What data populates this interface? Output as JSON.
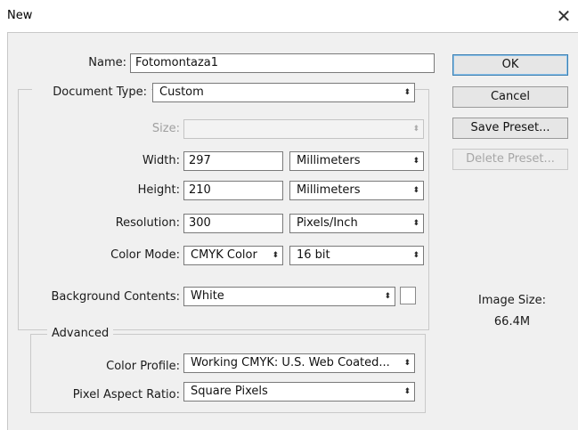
{
  "window": {
    "title": "New",
    "close_glyph": "✕"
  },
  "form": {
    "name_label": "Name:",
    "name_value": "Fotomontaza1",
    "document_type_label": "Document Type:",
    "document_type_value": "Custom",
    "size_label": "Size:",
    "size_value": "",
    "width_label": "Width:",
    "width_value": "297",
    "width_unit": "Millimeters",
    "height_label": "Height:",
    "height_value": "210",
    "height_unit": "Millimeters",
    "resolution_label": "Resolution:",
    "resolution_value": "300",
    "resolution_unit": "Pixels/Inch",
    "color_mode_label": "Color Mode:",
    "color_mode_value": "CMYK Color",
    "bit_depth_value": "16 bit",
    "background_label": "Background Contents:",
    "background_value": "White",
    "background_swatch_color": "#ffffff"
  },
  "advanced": {
    "legend": "Advanced",
    "color_profile_label": "Color Profile:",
    "color_profile_value": "Working CMYK:  U.S. Web Coated...",
    "pixel_aspect_label": "Pixel Aspect Ratio:",
    "pixel_aspect_value": "Square Pixels"
  },
  "buttons": {
    "ok": "OK",
    "cancel": "Cancel",
    "save_preset": "Save Preset...",
    "delete_preset": "Delete Preset..."
  },
  "image_size": {
    "label": "Image Size:",
    "value": "66.4M"
  },
  "colors": {
    "dialog_bg": "#f0f0f0",
    "default_button_border": "#3c7fb1"
  },
  "icons": {
    "select_arrows": "updown-arrows-icon",
    "close": "close-icon"
  },
  "arrow_glyph": "⬍"
}
